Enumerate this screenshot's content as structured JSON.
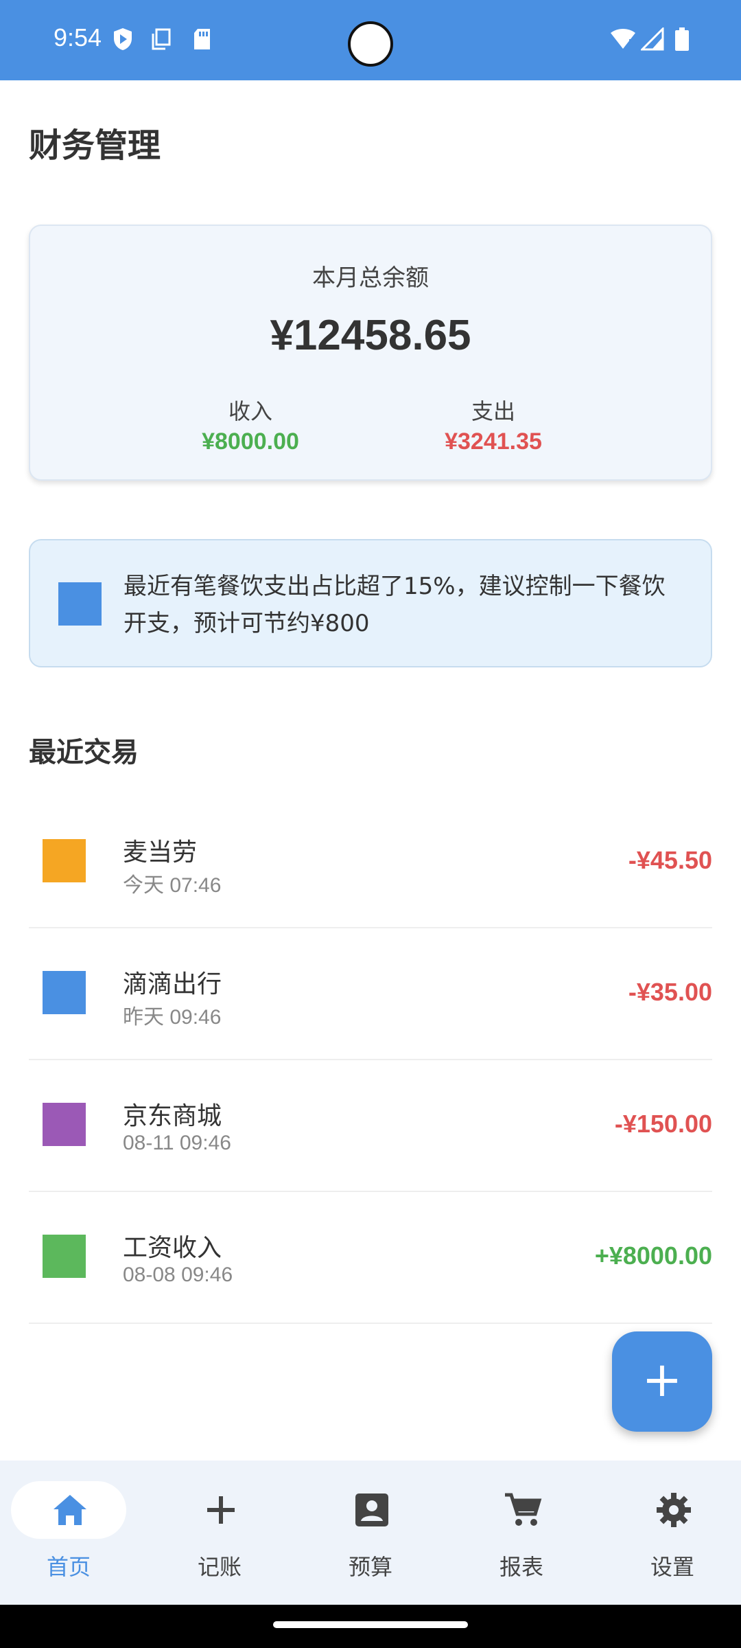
{
  "status_bar": {
    "time": "9:54",
    "background": "#4A90E2",
    "left_icons": [
      "play-shield-icon",
      "copy-icon",
      "sd-card-icon"
    ],
    "right_icons": [
      "wifi-icon",
      "cell-signal-icon",
      "battery-icon"
    ]
  },
  "header": {
    "title": "财务管理"
  },
  "balance": {
    "label": "本月总余额",
    "amount": "¥12458.65",
    "income_label": "收入",
    "income_value": "¥8000.00",
    "expense_label": "支出",
    "expense_value": "¥3241.35",
    "income_color": "#4CAF50",
    "expense_color": "#E05252"
  },
  "tip": {
    "icon": "tip-icon",
    "text": "最近有笔餐饮支出占比超了15%，建议控制一下餐饮开支，预计可节约¥800"
  },
  "recent": {
    "title": "最近交易",
    "items": [
      {
        "name": "麦当劳",
        "time": "今天 07:46",
        "amount": "-¥45.50",
        "icon_color": "#F5A623",
        "amount_color": "#E05252"
      },
      {
        "name": "滴滴出行",
        "time": "昨天 09:46",
        "amount": "-¥35.00",
        "icon_color": "#4A90E2",
        "amount_color": "#E05252"
      },
      {
        "name": "京东商城",
        "time": "08-11 09:46",
        "amount": "-¥150.00",
        "icon_color": "#9B59B6",
        "amount_color": "#E05252"
      },
      {
        "name": "工资收入",
        "time": "08-08 09:46",
        "amount": "+¥8000.00",
        "icon_color": "#5CB85C",
        "amount_color": "#4CAF50"
      }
    ]
  },
  "fab": {
    "label": "+"
  },
  "nav": {
    "items": [
      {
        "label": "首页",
        "icon": "home-icon",
        "active": true
      },
      {
        "label": "记账",
        "icon": "plus-icon",
        "active": false
      },
      {
        "label": "预算",
        "icon": "contact-card-icon",
        "active": false
      },
      {
        "label": "报表",
        "icon": "cart-icon",
        "active": false
      },
      {
        "label": "设置",
        "icon": "gear-icon",
        "active": false
      }
    ],
    "active_color": "#4A90E2",
    "inactive_color": "#444444"
  }
}
